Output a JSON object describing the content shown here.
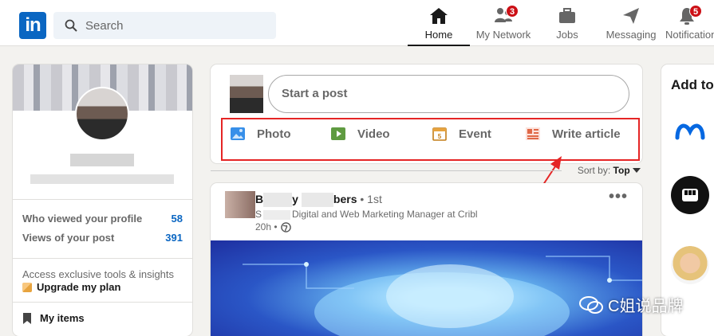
{
  "header": {
    "logo_text": "in",
    "search": {
      "placeholder": "Search"
    },
    "nav": [
      {
        "label": "Home",
        "icon": "home-icon",
        "active": true,
        "badge": ""
      },
      {
        "label": "My Network",
        "icon": "people-icon",
        "active": false,
        "badge": "3"
      },
      {
        "label": "Jobs",
        "icon": "briefcase-icon",
        "active": false,
        "badge": ""
      },
      {
        "label": "Messaging",
        "icon": "send-icon",
        "active": false,
        "badge": ""
      },
      {
        "label": "Notifications",
        "icon": "bell-icon",
        "active": false,
        "badge": "5"
      }
    ]
  },
  "profile_card": {
    "stats": [
      {
        "label": "Who viewed your profile",
        "value": "58"
      },
      {
        "label": "Views of your post",
        "value": "391"
      }
    ],
    "premium_text": "Access exclusive tools & insights",
    "upgrade_label": "Upgrade my plan",
    "my_items_label": "My items"
  },
  "share_box": {
    "start_post": "Start a post",
    "actions": [
      {
        "label": "Photo",
        "icon": "photo-icon",
        "color": "#378fe9"
      },
      {
        "label": "Video",
        "icon": "video-icon",
        "color": "#5f9b41"
      },
      {
        "label": "Event",
        "icon": "calendar-icon",
        "color": "#c37d16"
      },
      {
        "label": "Write article",
        "icon": "article-icon",
        "color": "#e06847"
      }
    ]
  },
  "sort": {
    "label": "Sort by:",
    "value": "Top"
  },
  "post": {
    "author_first": "B",
    "author_mid": "y",
    "author_last": "bers",
    "degree": "• 1st",
    "headline": "Digital and Web Marketing Manager at Cribl",
    "headline_prefix": "S",
    "time": "20h •",
    "more": "•••"
  },
  "right_panel": {
    "title": "Add to"
  },
  "watermark": {
    "text": "C姐说品牌"
  },
  "colors": {
    "brand": "#0a66c2",
    "badge": "#cc1016",
    "annotation": "#e52525"
  }
}
